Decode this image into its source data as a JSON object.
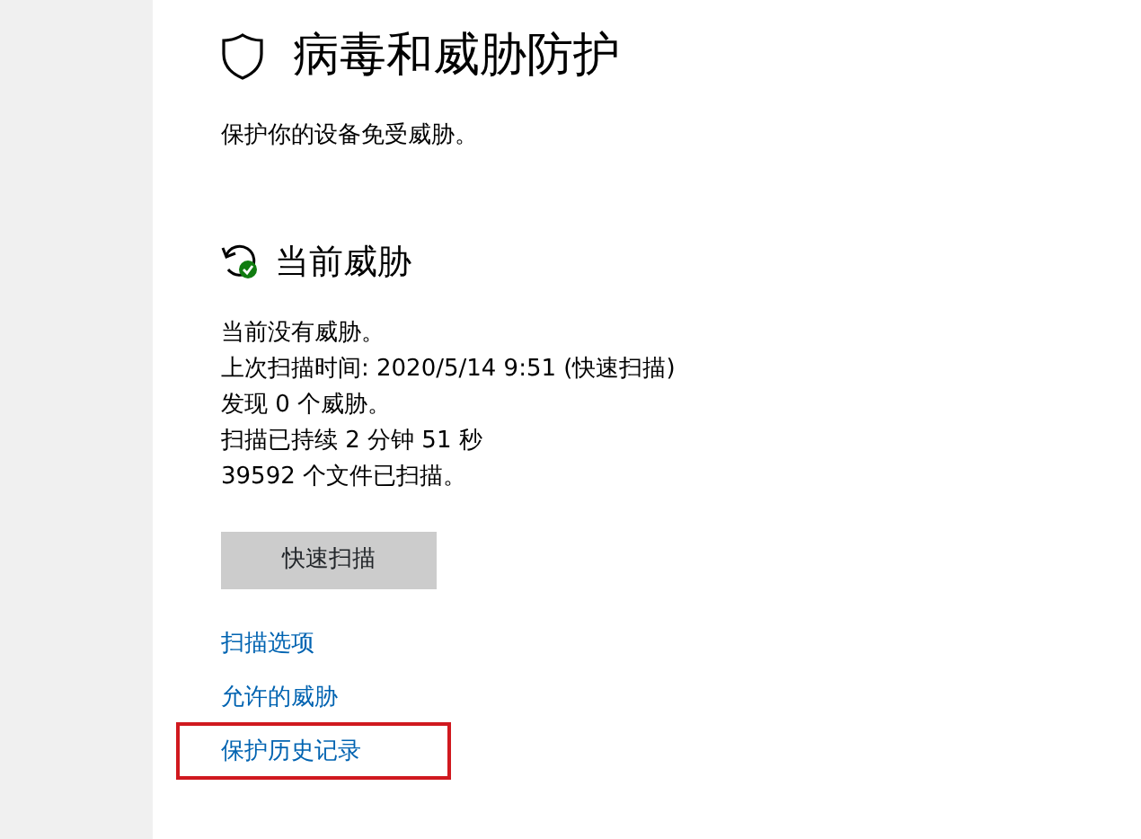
{
  "page": {
    "title": "病毒和威胁防护",
    "subtitle": "保护你的设备免受威胁。"
  },
  "section": {
    "heading": "当前威胁",
    "lines": [
      "当前没有威胁。",
      "上次扫描时间: 2020/5/14 9:51 (快速扫描)",
      "发现 0 个威胁。",
      "扫描已持续 2 分钟 51 秒",
      "39592 个文件已扫描。"
    ],
    "button": "快速扫描",
    "links": [
      {
        "label": "扫描选项",
        "highlighted": false
      },
      {
        "label": "允许的威胁",
        "highlighted": false
      },
      {
        "label": "保护历史记录",
        "highlighted": true
      }
    ]
  }
}
